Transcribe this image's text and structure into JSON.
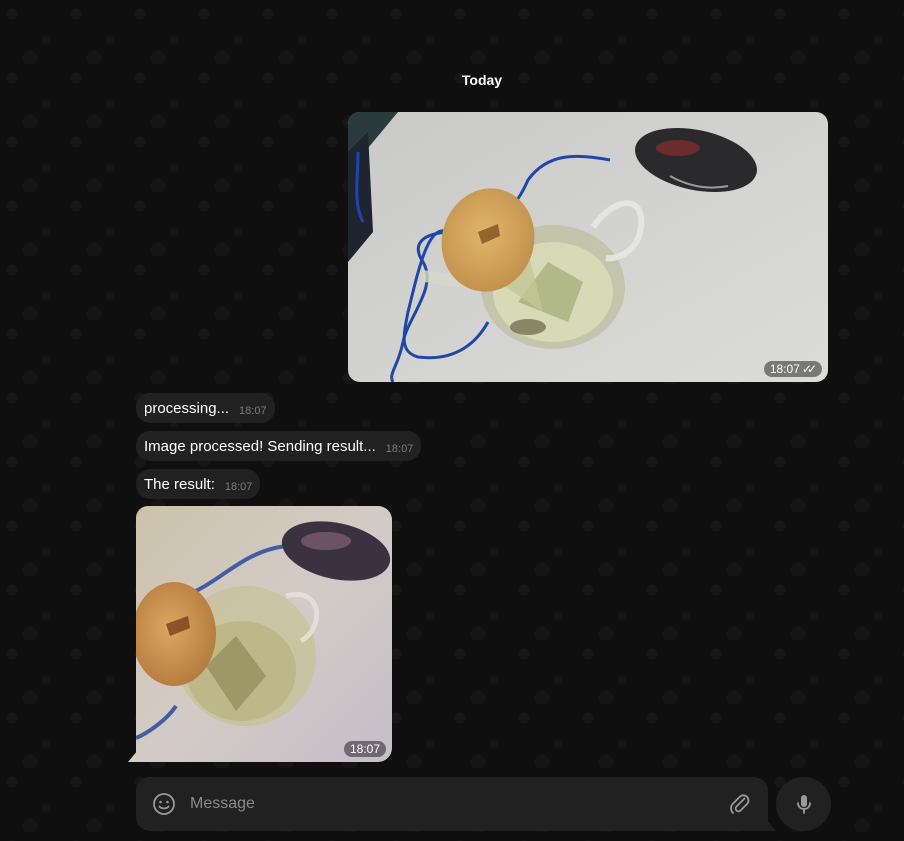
{
  "chat": {
    "date_label": "Today",
    "outgoing_photo": {
      "time": "18:07",
      "status": "read"
    },
    "messages": [
      {
        "text": "processing...",
        "time": "18:07"
      },
      {
        "text": "Image processed! Sending result...",
        "time": "18:07"
      },
      {
        "text": "The result:",
        "time": "18:07"
      }
    ],
    "incoming_photo": {
      "time": "18:07"
    }
  },
  "composer": {
    "placeholder": "Message",
    "value": ""
  },
  "colors": {
    "background": "#0f0f0f",
    "bubble": "#212121",
    "timestamp": "#7b7b7b"
  }
}
